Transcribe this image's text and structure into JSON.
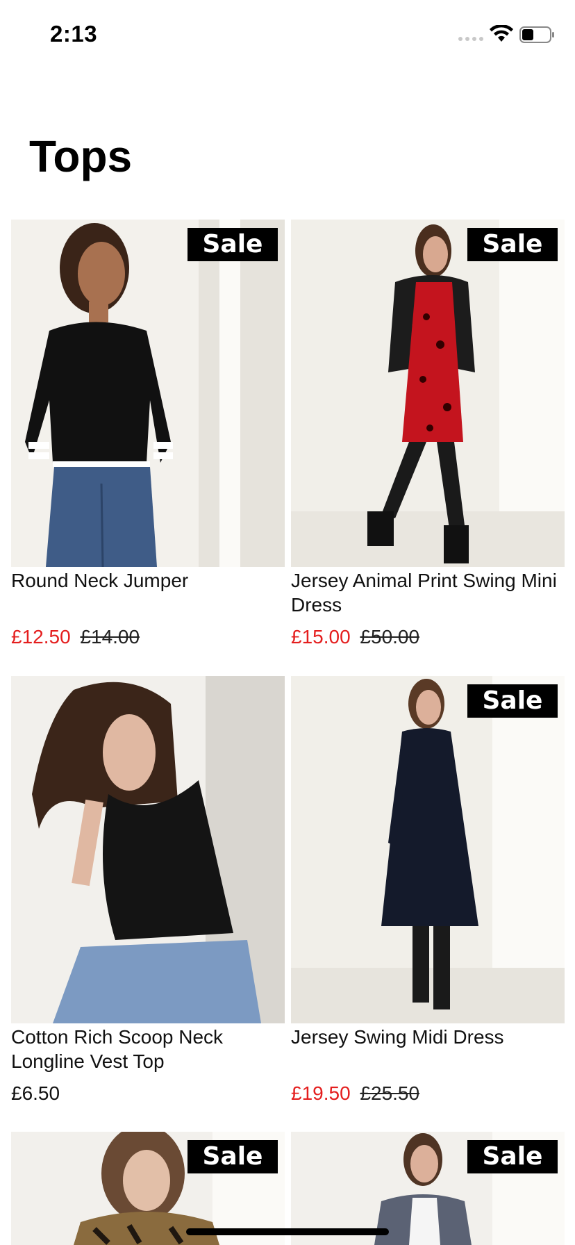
{
  "status_bar": {
    "time": "2:13"
  },
  "page": {
    "title": "Tops"
  },
  "products": [
    {
      "name": "Round Neck Jumper",
      "sale_badge": "Sale",
      "price": "£12.50",
      "was_price": "£14.00",
      "on_sale": true
    },
    {
      "name": "Jersey Animal Print Swing Mini Dress",
      "sale_badge": "Sale",
      "price": "£15.00",
      "was_price": "£50.00",
      "on_sale": true
    },
    {
      "name": "Cotton Rich Scoop Neck Longline Vest Top",
      "sale_badge": "",
      "price": "£6.50",
      "was_price": "",
      "on_sale": false
    },
    {
      "name": "Jersey Swing Midi Dress",
      "sale_badge": "Sale",
      "price": "£19.50",
      "was_price": "£25.50",
      "on_sale": true
    },
    {
      "name": "",
      "sale_badge": "Sale",
      "price": "",
      "was_price": "",
      "on_sale": true
    },
    {
      "name": "",
      "sale_badge": "Sale",
      "price": "",
      "was_price": "",
      "on_sale": true
    }
  ],
  "colors": {
    "sale_price": "#e41e1e",
    "badge_background": "#000000",
    "badge_text": "#ffffff"
  }
}
